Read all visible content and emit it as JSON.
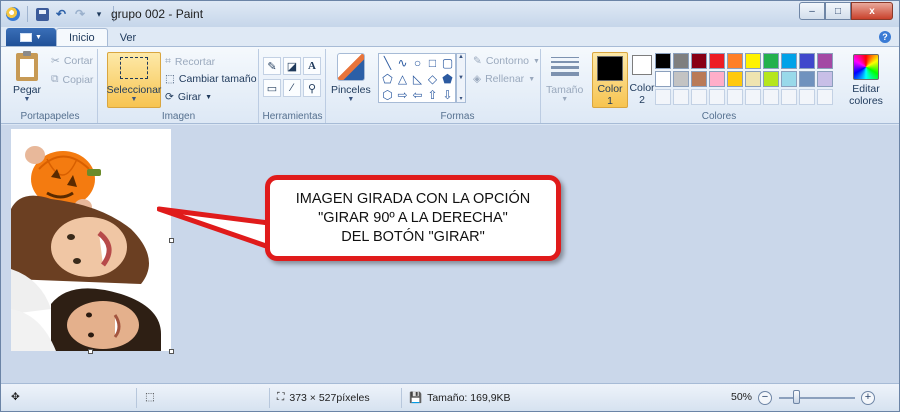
{
  "window": {
    "title": "grupo 002 - Paint",
    "controls": {
      "minimize": "–",
      "maximize": "□",
      "close": "x"
    }
  },
  "tabs": {
    "file_label": "",
    "items": [
      {
        "label": "Inicio",
        "active": true
      },
      {
        "label": "Ver",
        "active": false
      }
    ],
    "help": "?"
  },
  "ribbon": {
    "portapapeles": {
      "label": "Portapapeles",
      "paste": "Pegar",
      "cut": "Cortar",
      "copy": "Copiar"
    },
    "imagen": {
      "label": "Imagen",
      "select": "Seleccionar",
      "crop": "Recortar",
      "resize": "Cambiar tamaño",
      "rotate": "Girar"
    },
    "herramientas": {
      "label": "Herramientas"
    },
    "pinceles": {
      "label": "Pinceles"
    },
    "formas": {
      "label": "Formas",
      "outline": "Contorno",
      "fill": "Rellenar"
    },
    "tamano": {
      "label": "Tamaño"
    },
    "colores": {
      "label": "Colores",
      "color1_line1": "Color",
      "color1_line2": "1",
      "color2_line1": "Color",
      "color2_line2": "2",
      "edit_line1": "Editar",
      "edit_line2": "colores",
      "color1_value": "#000000",
      "color2_value": "#ffffff",
      "palette": [
        "#000000",
        "#7f7f7f",
        "#880015",
        "#ed1c24",
        "#ff7f27",
        "#fff200",
        "#22b14c",
        "#00a2e8",
        "#3f48cc",
        "#a349a4",
        "#ffffff",
        "#c3c3c3",
        "#b97a57",
        "#ffaec9",
        "#ffc90e",
        "#efe4b0",
        "#b5e61d",
        "#99d9ea",
        "#7092be",
        "#c8bfe7"
      ]
    }
  },
  "callout": {
    "line1": "IMAGEN GIRADA CON LA OPCIÓN",
    "line2": "\"GIRAR 90º A LA DERECHA\"",
    "line3": "DEL BOTÓN \"GIRAR\""
  },
  "statusbar": {
    "dimensions": "373 × 527píxeles",
    "size": "Tamaño: 169,9KB",
    "zoom": "50%"
  }
}
